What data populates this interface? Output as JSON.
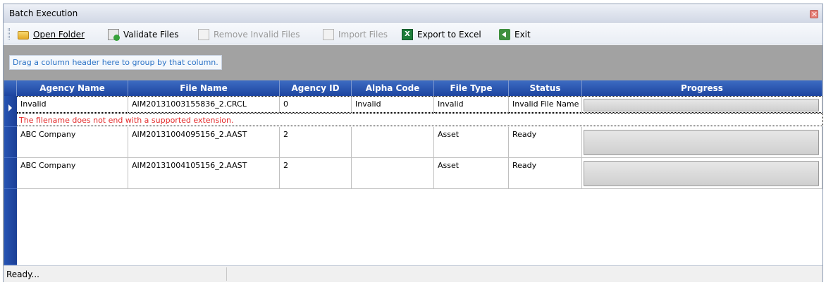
{
  "window": {
    "title": "Batch Execution"
  },
  "toolbar": {
    "open_folder": "Open Folder",
    "validate_files": "Validate Files",
    "remove_invalid_files": "Remove Invalid Files",
    "import_files": "Import Files",
    "export_to_excel": "Export to Excel",
    "exit": "Exit"
  },
  "group_panel": {
    "hint": "Drag a column header here to group by that column."
  },
  "grid": {
    "columns": [
      "Agency Name",
      "File Name",
      "Agency ID",
      "Alpha Code",
      "File Type",
      "Status",
      "Progress"
    ],
    "rows": [
      {
        "agency_name": "Invalid",
        "file_name": "AIM20131003155836_2.CRCL",
        "agency_id": "0",
        "alpha_code": "Invalid",
        "file_type": "Invalid",
        "status": "Invalid File Name",
        "error": "The filename does not end with a supported extension."
      },
      {
        "agency_name": "ABC Company",
        "file_name": "AIM20131004095156_2.AAST",
        "agency_id": "2",
        "alpha_code": "",
        "file_type": "Asset",
        "status": "Ready"
      },
      {
        "agency_name": "ABC Company",
        "file_name": "AIM20131004105156_2.AAST",
        "agency_id": "2",
        "alpha_code": "",
        "file_type": "Asset",
        "status": "Ready"
      }
    ]
  },
  "statusbar": {
    "text": "Ready..."
  },
  "colors": {
    "header_blue": "#1d44a0",
    "error_red": "#e32a2a",
    "group_gray": "#a2a2a2"
  }
}
